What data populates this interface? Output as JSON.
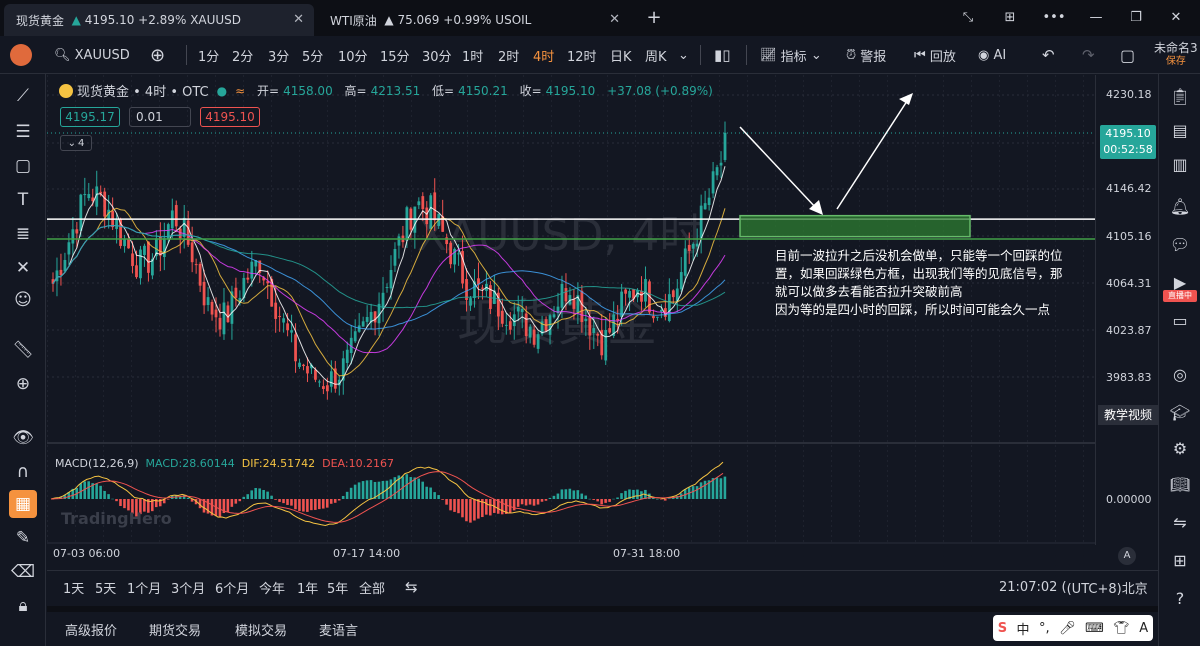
{
  "tabs": [
    {
      "label": "现货黄金",
      "arrow": "▲",
      "price": "4195.10",
      "change": "+2.89%",
      "symbol": "XAUUSD"
    },
    {
      "label": "WTI原油",
      "arrow": "▲",
      "price": "75.069",
      "change": "+0.99%",
      "symbol": "USOIL"
    }
  ],
  "toolbar": {
    "symbol": "XAUUSD",
    "intervals": [
      "1分",
      "2分",
      "3分",
      "5分",
      "10分",
      "15分",
      "30分",
      "1时",
      "2时",
      "4时",
      "12时",
      "日K",
      "周K"
    ],
    "active_interval": "4时",
    "indicators": "指标",
    "alert": "警报",
    "replay": "回放",
    "ai": "AI",
    "layout_name": "未命名3",
    "save": "保存"
  },
  "legend": {
    "title": "现货黄金 • 4时 • OTC",
    "open_label": "开=",
    "open": "4158.00",
    "high_label": "高=",
    "high": "4213.51",
    "low_label": "低=",
    "low": "4150.21",
    "close_label": "收=",
    "close": "4195.10",
    "change": "+37.08 (+0.89%)",
    "bid": "4195.17",
    "spread": "0.01",
    "ask": "4195.10",
    "indicator_count": "4"
  },
  "watermark": {
    "line1": "XAUUSD, 4时",
    "line2": "现货黄金"
  },
  "logo": "TradingHero",
  "annotation": "目前一波拉升之后没机会做单，只能等一个回踩的位置，如果回踩绿色方框，出现我们等的见底信号，那就可以做多去看能否拉升突破前高\n因为等的是四小时的回踩，所以时间可能会久一点",
  "macd": {
    "label": "MACD(12,26,9)",
    "macd": "MACD:28.60144",
    "dif": "DIF:24.51742",
    "dea": "DEA:10.2167",
    "zero": "0.00000"
  },
  "price_axis": {
    "labels": [
      "4230.18",
      "4146.42",
      "4105.16",
      "4064.31",
      "4023.87",
      "3983.83"
    ],
    "current": "4195.10",
    "countdown": "00:52:58",
    "teach": "教学视频",
    "live": "直播中"
  },
  "time_axis": [
    "07-03 06:00",
    "07-17 14:00",
    "07-31 18:00"
  ],
  "ranges": [
    "1天",
    "5天",
    "1个月",
    "3个月",
    "6个月",
    "今年",
    "1年",
    "5年",
    "全部"
  ],
  "clock": "21:07:02",
  "timezone": "(UTC+8)北京",
  "bottom_tabs": [
    "高级报价",
    "期货交易",
    "模拟交易",
    "麦语言"
  ],
  "ime": [
    "中",
    "°,"
  ],
  "colors": {
    "up": "#26a69a",
    "down": "#ef5350",
    "accent": "#f5923e",
    "zone": "#2e7d32"
  },
  "chart_data": {
    "type": "candlestick",
    "ylim": [
      3950,
      4250
    ],
    "levels": {
      "white_line": 4135,
      "green_line": 4118,
      "zone": [
        4120,
        4138
      ]
    },
    "trend_samples": [
      4080,
      4120,
      4160,
      4150,
      4120,
      4095,
      4105,
      4140,
      4110,
      4060,
      4050,
      4080,
      4100,
      4060,
      4020,
      4000,
      3995,
      4010,
      4040,
      4070,
      4110,
      4150,
      4140,
      4110,
      4080,
      4070,
      4060,
      4050,
      4040,
      4060,
      4080,
      4050,
      4030,
      4060,
      4080,
      4060,
      4070,
      4110,
      4150,
      4195
    ]
  }
}
